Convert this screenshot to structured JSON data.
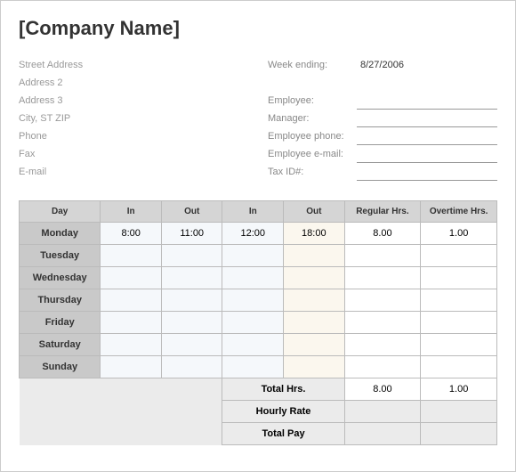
{
  "title": "[Company Name]",
  "address": {
    "street": "Street Address",
    "addr2": "Address 2",
    "addr3": "Address 3",
    "city": "City, ST  ZIP",
    "phone": "Phone",
    "fax": "Fax",
    "email": "E-mail"
  },
  "info": {
    "week_ending_label": "Week ending:",
    "week_ending_value": "8/27/2006",
    "employee_label": "Employee:",
    "employee_value": "",
    "manager_label": "Manager:",
    "manager_value": "",
    "emp_phone_label": "Employee phone:",
    "emp_phone_value": "",
    "emp_email_label": "Employee e-mail:",
    "emp_email_value": "",
    "tax_id_label": "Tax ID#:",
    "tax_id_value": ""
  },
  "table": {
    "headers": {
      "day": "Day",
      "in1": "In",
      "out1": "Out",
      "in2": "In",
      "out2": "Out",
      "reg": "Regular Hrs.",
      "ot": "Overtime Hrs."
    },
    "rows": [
      {
        "day": "Monday",
        "in1": "8:00",
        "out1": "11:00",
        "in2": "12:00",
        "out2": "18:00",
        "reg": "8.00",
        "ot": "1.00"
      },
      {
        "day": "Tuesday",
        "in1": "",
        "out1": "",
        "in2": "",
        "out2": "",
        "reg": "",
        "ot": ""
      },
      {
        "day": "Wednesday",
        "in1": "",
        "out1": "",
        "in2": "",
        "out2": "",
        "reg": "",
        "ot": ""
      },
      {
        "day": "Thursday",
        "in1": "",
        "out1": "",
        "in2": "",
        "out2": "",
        "reg": "",
        "ot": ""
      },
      {
        "day": "Friday",
        "in1": "",
        "out1": "",
        "in2": "",
        "out2": "",
        "reg": "",
        "ot": ""
      },
      {
        "day": "Saturday",
        "in1": "",
        "out1": "",
        "in2": "",
        "out2": "",
        "reg": "",
        "ot": ""
      },
      {
        "day": "Sunday",
        "in1": "",
        "out1": "",
        "in2": "",
        "out2": "",
        "reg": "",
        "ot": ""
      }
    ],
    "totals": {
      "total_hrs_label": "Total Hrs.",
      "total_reg": "8.00",
      "total_ot": "1.00",
      "hourly_rate_label": "Hourly Rate",
      "hourly_rate_reg": "",
      "hourly_rate_ot": "",
      "total_pay_label": "Total Pay",
      "total_pay_reg": "",
      "total_pay_ot": ""
    }
  }
}
